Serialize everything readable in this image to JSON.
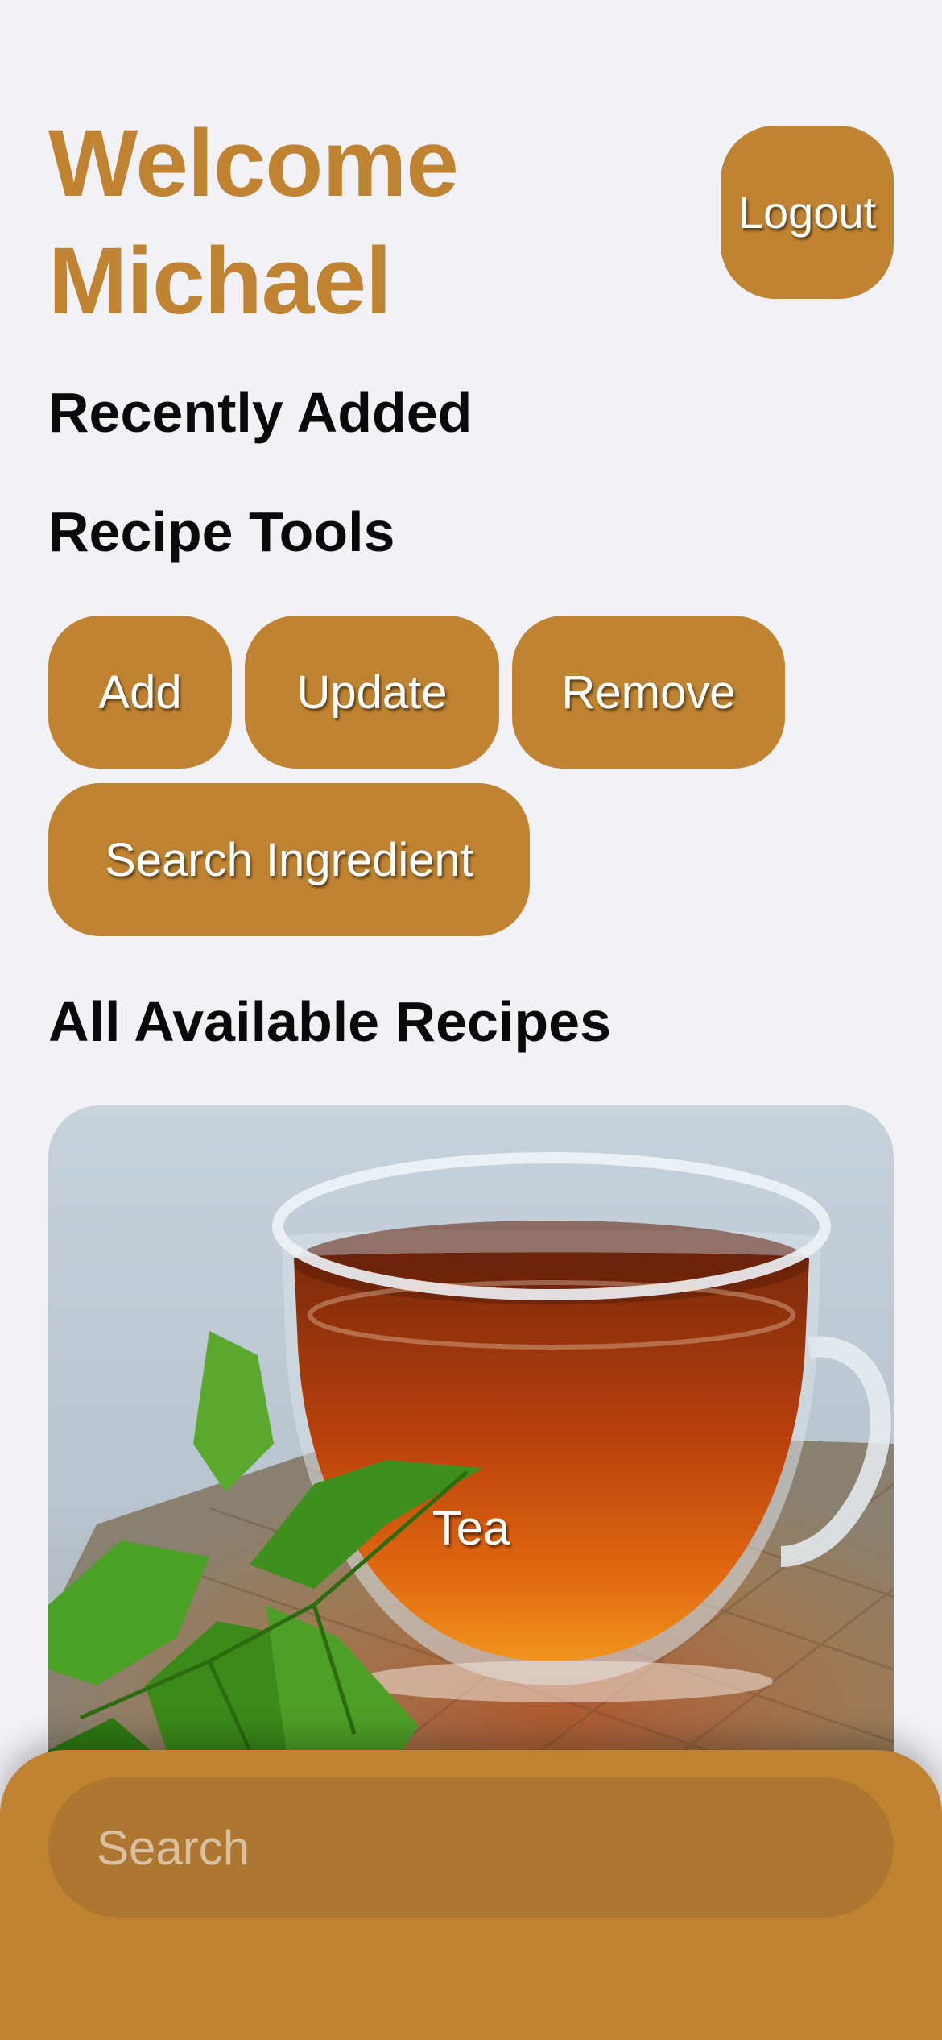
{
  "header": {
    "greeting_line1": "Welcome",
    "greeting_line2": "Michael",
    "logout_label": "Logout"
  },
  "sections": {
    "recently_added": "Recently Added",
    "recipe_tools": "Recipe Tools",
    "all_recipes": "All Available Recipes"
  },
  "tools": {
    "add_label": "Add",
    "update_label": "Update",
    "remove_label": "Remove",
    "search_ingredient_label": "Search Ingredient"
  },
  "recipes": [
    {
      "name": "Tea"
    }
  ],
  "search": {
    "placeholder": "Search"
  },
  "colors": {
    "accent": "#bf8331",
    "background": "#f2f1f6"
  }
}
